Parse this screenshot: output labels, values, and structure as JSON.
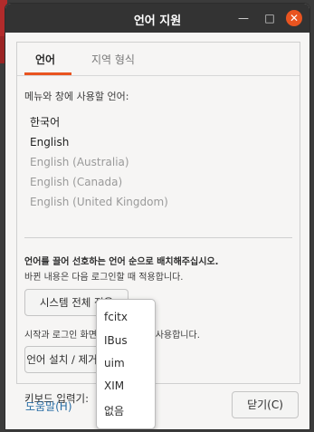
{
  "window": {
    "title": "언어 지원"
  },
  "tabs": [
    {
      "label": "언어"
    },
    {
      "label": "지역 형식"
    }
  ],
  "language": {
    "menu_label": "메뉴와 창에 사용할 언어:",
    "items": [
      "한국어",
      "English",
      "English (Australia)",
      "English (Canada)",
      "English (United Kingdom)"
    ],
    "drag_hint": "언어를 끌어 선호하는 언어 순으로 배치해주십시오.",
    "apply_note": "바뀐 내용은 다음 로그인할 때 적용합니다.",
    "apply_button": "시스템 전체 적용",
    "login_note": "시작과 로그인 화면에 같은 언어를 사용합니다.",
    "install_button": "언어 설치 / 제거...",
    "keyboard_label": "키보드 입력기:"
  },
  "input_method_menu": {
    "options": [
      "fcitx",
      "IBus",
      "uim",
      "XIM",
      "없음"
    ]
  },
  "footer": {
    "help_label": "도움말(H)",
    "close_label": "닫기(C)"
  },
  "colors": {
    "accent": "#e95420",
    "titlebar": "#333333",
    "link": "#2a6ea6"
  }
}
